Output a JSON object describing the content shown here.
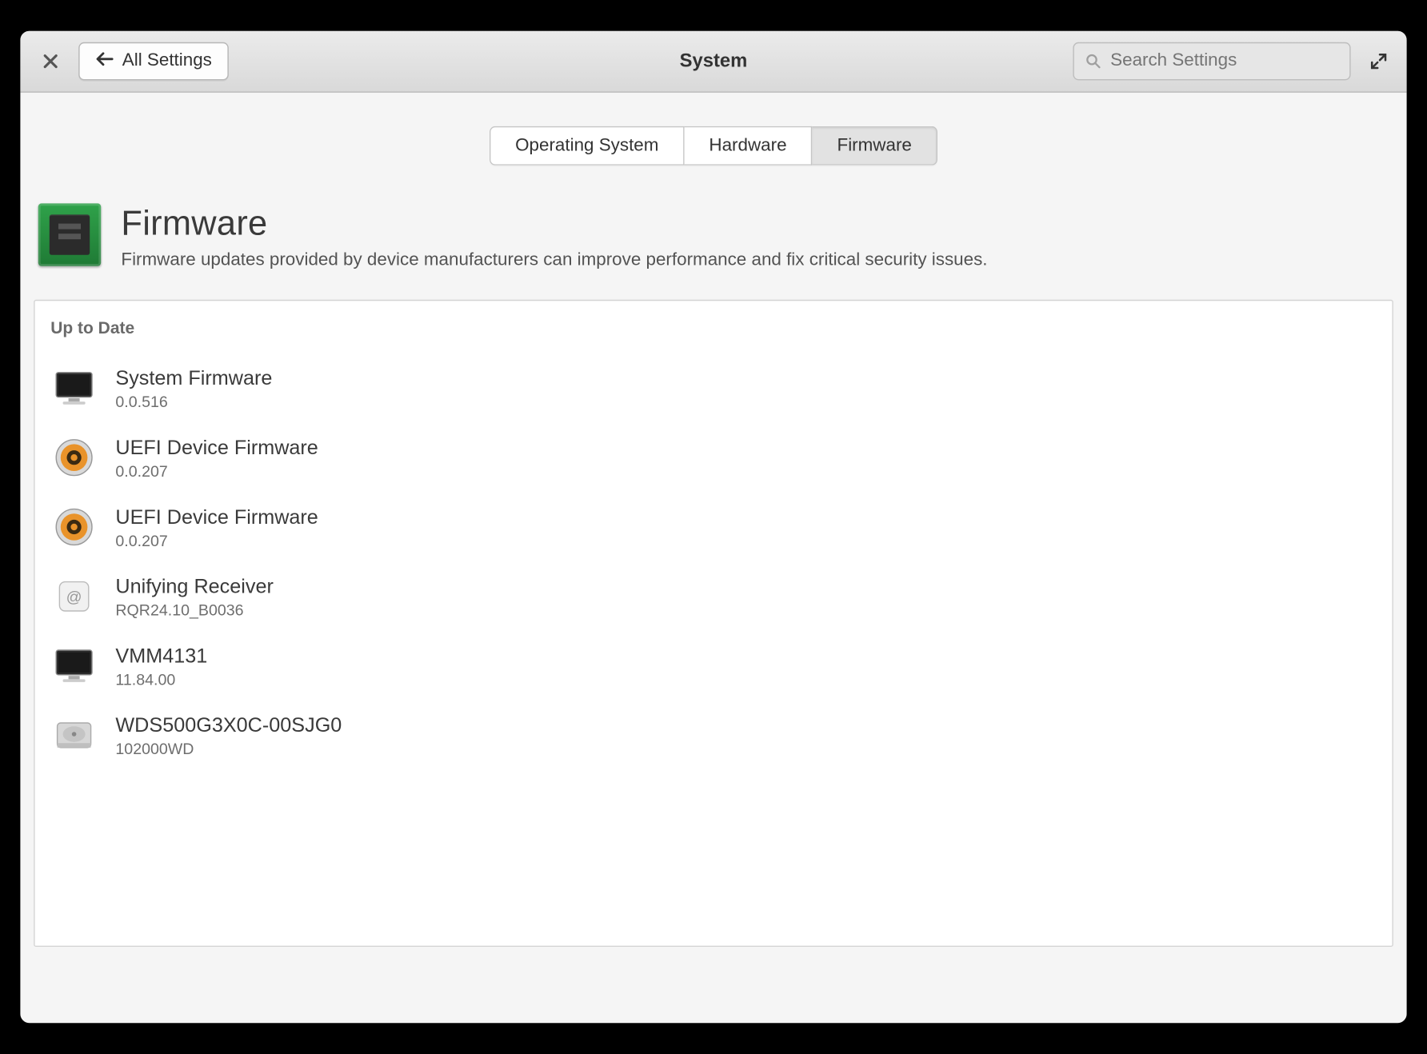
{
  "header": {
    "title": "System",
    "back_label": "All Settings",
    "search_placeholder": "Search Settings"
  },
  "tabs": [
    {
      "label": "Operating System",
      "active": false
    },
    {
      "label": "Hardware",
      "active": false
    },
    {
      "label": "Firmware",
      "active": true
    }
  ],
  "hero": {
    "title": "Firmware",
    "subtitle": "Firmware updates provided by device manufacturers can improve performance and fix critical security issues."
  },
  "section_label": "Up to Date",
  "devices": [
    {
      "name": "System Firmware",
      "version": "0.0.516",
      "icon": "monitor"
    },
    {
      "name": "UEFI Device Firmware",
      "version": "0.0.207",
      "icon": "speaker"
    },
    {
      "name": "UEFI Device Firmware",
      "version": "0.0.207",
      "icon": "speaker"
    },
    {
      "name": "Unifying Receiver",
      "version": "RQR24.10_B0036",
      "icon": "receiver"
    },
    {
      "name": "VMM4131",
      "version": "11.84.00",
      "icon": "monitor"
    },
    {
      "name": "WDS500G3X0C-00SJG0",
      "version": "102000WD",
      "icon": "disk"
    }
  ]
}
